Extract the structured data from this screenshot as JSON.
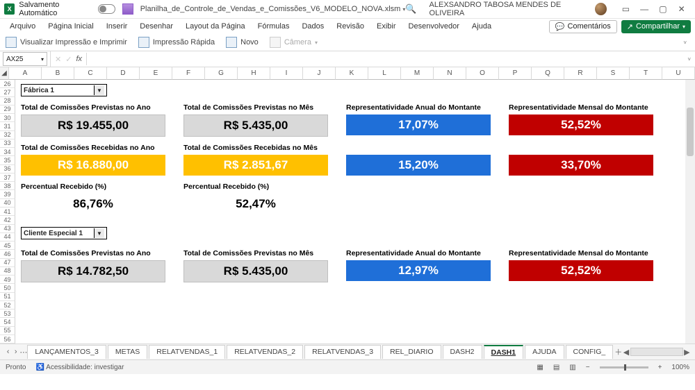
{
  "title": {
    "autosave": "Salvamento Automático",
    "filename": "Planilha_de_Controle_de_Vendas_e_Comissões_V6_MODELO_NOVA.xlsm",
    "user": "ALEXSANDRO TABOSA MENDES DE OLIVEIRA"
  },
  "menu": [
    "Arquivo",
    "Página Inicial",
    "Inserir",
    "Desenhar",
    "Layout da Página",
    "Fórmulas",
    "Dados",
    "Revisão",
    "Exibir",
    "Desenvolvedor",
    "Ajuda"
  ],
  "actions": {
    "comments": "Comentários",
    "share": "Compartilhar"
  },
  "toolbar": {
    "print_preview": "Visualizar Impressão e Imprimir",
    "quick_print": "Impressão Rápida",
    "new": "Novo",
    "camera": "Câmera"
  },
  "namebox": "AX25",
  "columns": [
    "A",
    "B",
    "C",
    "D",
    "E",
    "F",
    "G",
    "H",
    "I",
    "J",
    "K",
    "L",
    "M",
    "N",
    "O",
    "P",
    "Q",
    "R",
    "S",
    "T",
    "U"
  ],
  "rows": [
    26,
    27,
    28,
    29,
    30,
    31,
    32,
    33,
    34,
    35,
    36,
    37,
    38,
    39,
    40,
    41,
    42,
    43,
    44,
    45,
    46,
    47,
    48,
    49,
    50,
    51,
    52,
    53,
    54,
    55,
    56
  ],
  "dash": {
    "dd1": "Fábrica 1",
    "dd2": "Cliente Especial 1",
    "labels": {
      "com_prev_ano": "Total de Comissões Previstas no Ano",
      "com_prev_mes": "Total de Comissões Previstas no Mês",
      "rep_anual": "Representatividade Anual do Montante",
      "rep_mensal": "Representatividade Mensal do Montante",
      "com_rec_ano": "Total de Comissões Recebidas no Ano",
      "com_rec_mes": "Total de Comissões Recebidas no Mês",
      "perc_rec": "Percentual Recebido (%)"
    },
    "sec1": {
      "prev_ano": "R$ 19.455,00",
      "prev_mes": "R$ 5.435,00",
      "rep_anual": "17,07%",
      "rep_mensal": "52,52%",
      "rec_ano": "R$ 16.880,00",
      "rec_mes": "R$ 2.851,67",
      "rep_anual2": "15,20%",
      "rep_mensal2": "33,70%",
      "perc_ano": "86,76%",
      "perc_mes": "52,47%"
    },
    "sec2": {
      "prev_ano": "R$ 14.782,50",
      "prev_mes": "R$ 5.435,00",
      "rep_anual": "12,97%",
      "rep_mensal": "52,52%"
    }
  },
  "tabs": [
    "LANÇAMENTOS_3",
    "METAS",
    "RELATVENDAS_1",
    "RELATVENDAS_2",
    "RELATVENDAS_3",
    "REL_DIARIO",
    "DASH2",
    "DASH1",
    "AJUDA",
    "CONFIG_"
  ],
  "active_tab": "DASH1",
  "status": {
    "ready": "Pronto",
    "accessibility": "Acessibilidade: investigar",
    "zoom": "100%"
  }
}
